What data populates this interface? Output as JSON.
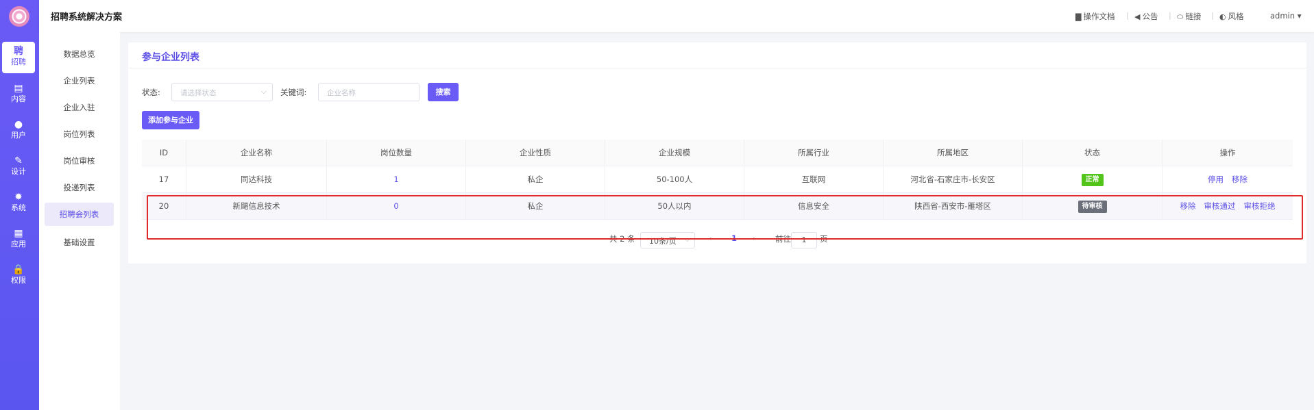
{
  "app": {
    "title": "招聘系统解决方案"
  },
  "header": {
    "links": [
      {
        "label": "操作文档",
        "icon": "book-icon"
      },
      {
        "label": "公告",
        "icon": "speaker-icon"
      },
      {
        "label": "链接",
        "icon": "link-icon"
      },
      {
        "label": "风格",
        "icon": "palette-icon"
      }
    ],
    "user": "admin",
    "user_caret": "▾"
  },
  "rail": {
    "items": [
      {
        "label": "招聘",
        "glyph": "聘",
        "icon": "recruit-icon",
        "active": true
      },
      {
        "label": "内容",
        "glyph": "▤",
        "icon": "document-icon"
      },
      {
        "label": "用户",
        "glyph": "●",
        "icon": "user-icon"
      },
      {
        "label": "设计",
        "glyph": "✎",
        "icon": "brush-icon"
      },
      {
        "label": "系统",
        "glyph": "✹",
        "icon": "gear-icon"
      },
      {
        "label": "应用",
        "glyph": "▦",
        "icon": "apps-icon"
      },
      {
        "label": "权限",
        "glyph": "🔒",
        "icon": "lock-icon"
      }
    ]
  },
  "submenu": {
    "items": [
      {
        "label": "数据总览"
      },
      {
        "label": "企业列表"
      },
      {
        "label": "企业入驻"
      },
      {
        "label": "岗位列表"
      },
      {
        "label": "岗位审核"
      },
      {
        "label": "投递列表"
      },
      {
        "label": "招聘会列表",
        "active": true
      },
      {
        "label": "基础设置"
      }
    ]
  },
  "card": {
    "title": "参与企业列表",
    "filters": {
      "status_label": "状态:",
      "status_placeholder": "请选择状态",
      "keyword_label": "关键词:",
      "keyword_placeholder": "企业名称",
      "search_label": "搜索"
    },
    "add_button": "添加参与企业",
    "table": {
      "columns": [
        "ID",
        "企业名称",
        "岗位数量",
        "企业性质",
        "企业规模",
        "所属行业",
        "所属地区",
        "状态",
        "操作"
      ],
      "rows": [
        {
          "id": "17",
          "name": "同达科技",
          "jobs": "1",
          "nature": "私企",
          "scale": "50-100人",
          "industry": "互联网",
          "region": "河北省-石家庄市-长安区",
          "status": "正常",
          "status_color": "#52c41a",
          "actions": [
            "停用",
            "移除"
          ]
        },
        {
          "id": "20",
          "name": "新飓信息技术",
          "jobs": "0",
          "nature": "私企",
          "scale": "50人以内",
          "industry": "信息安全",
          "region": "陕西省-西安市-雁塔区",
          "status": "待审核",
          "status_color": "#6b6f7a",
          "actions": [
            "移除",
            "审核通过",
            "审核拒绝"
          ]
        }
      ]
    },
    "pagination": {
      "total": "共 2 条",
      "page_size": "10条/页",
      "prev": "‹",
      "current": "1",
      "next": "›",
      "goto_label": "前往",
      "goto_value": "1",
      "page_suffix": "页"
    }
  }
}
